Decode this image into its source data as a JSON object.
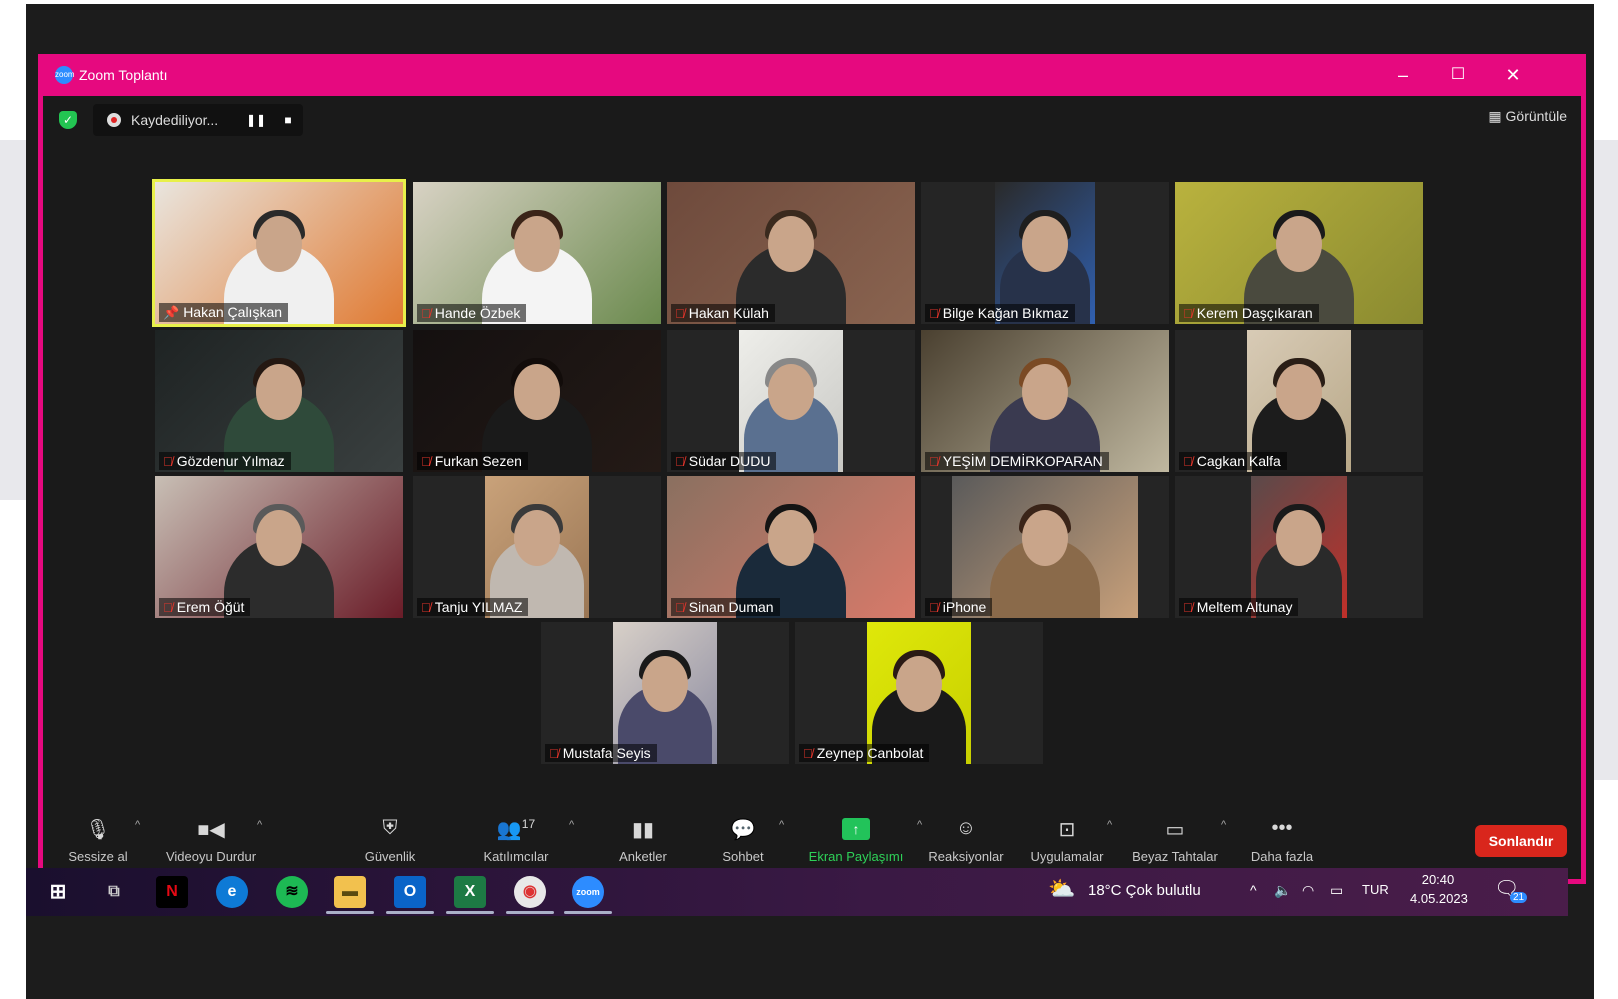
{
  "window": {
    "title": "Zoom Toplantı",
    "minimize": "–",
    "maximize": "☐",
    "close": "✕"
  },
  "topbar": {
    "recording_label": "Kaydediliyor...",
    "pause": "❚❚",
    "stop": "■",
    "view_label": "Görüntüle"
  },
  "participants": [
    {
      "name": "Hakan Çalışkan",
      "pinned": true,
      "bg": "#e9e5de",
      "accent": "#e07a32",
      "shirt": "#f0f0f0",
      "hair": "#2a2a2a"
    },
    {
      "name": "Hande Özbek",
      "muted": false,
      "bg": "#d8d2c4",
      "accent": "#6b8a4e",
      "shirt": "#f4f4f4",
      "hair": "#3a2418"
    },
    {
      "name": "Hakan Külah",
      "bg": "#6e4a3c",
      "accent": "#8a6450",
      "shirt": "#2b2b2b",
      "hair": "#3a2a1e"
    },
    {
      "name": "Bilge Kağan Bıkmaz",
      "bg": "#2a2a2a",
      "accent": "#3060b0",
      "shirt": "#27324a",
      "hair": "#1e1e1e"
    },
    {
      "name": "Kerem Daşçıkaran",
      "bg": "#b9b23e",
      "accent": "#8a8a30",
      "shirt": "#4a4a3e",
      "hair": "#1a1a1a"
    },
    {
      "name": "Gözdenur Yılmaz",
      "bg": "#1e2323",
      "accent": "#3a4040",
      "shirt": "#2f4a3a",
      "hair": "#241812"
    },
    {
      "name": "Furkan Sezen",
      "bg": "#141010",
      "accent": "#241a16",
      "shirt": "#1a1a1a",
      "hair": "#120c0a"
    },
    {
      "name": "Südar DUDU",
      "bg": "#eeeeea",
      "accent": "#c8c8c4",
      "shirt": "#5a7090",
      "hair": "#888"
    },
    {
      "name": "YEŞİM DEMİRKOPARAN",
      "bg": "#4a4030",
      "accent": "#c0b8a0",
      "shirt": "#3a3a50",
      "hair": "#7a4a24"
    },
    {
      "name": "Cagkan Kalfa",
      "bg": "#d8cbb6",
      "accent": "#b8a888",
      "shirt": "#1c1c1c",
      "hair": "#2a1e16"
    },
    {
      "name": "Erem Öğüt",
      "bg": "#c8bfb5",
      "accent": "#6a1c28",
      "shirt": "#2c2c2c",
      "hair": "#5a5a5a"
    },
    {
      "name": "Tanju YILMAZ",
      "bg": "#c9a27a",
      "accent": "#9a7654",
      "shirt": "#c0b8b0",
      "hair": "#3a3a3a"
    },
    {
      "name": "Sinan Duman",
      "bg": "#8a7060",
      "accent": "#d87a6a",
      "shirt": "#1a2a3a",
      "hair": "#141414"
    },
    {
      "name": "iPhone",
      "bg": "#5a5a5a",
      "accent": "#c8a07a",
      "shirt": "#8a6a4a",
      "hair": "#3a2418"
    },
    {
      "name": "Meltem Altunay",
      "bg": "#5a4a4a",
      "accent": "#c0302a",
      "shirt": "#2a2a2a",
      "hair": "#1a1a1a"
    },
    {
      "name": "Mustafa Seyis",
      "bg": "#d8d0c8",
      "accent": "#8a8aa0",
      "shirt": "#4a4a6a",
      "hair": "#1a1a1a"
    },
    {
      "name": "Zeynep Canbolat",
      "bg": "#dfe80a",
      "accent": "#c8d000",
      "shirt": "#1a1a1a",
      "hair": "#2a1a14"
    }
  ],
  "toolbar": {
    "mute": "Sessize al",
    "video": "Videoyu Durdur",
    "security": "Güvenlik",
    "participants": "Katılımcılar",
    "participants_count": "17",
    "polls": "Anketler",
    "chat": "Sohbet",
    "share": "Ekran Paylaşımı",
    "reactions": "Reaksiyonlar",
    "apps": "Uygulamalar",
    "whiteboards": "Beyaz Tahtalar",
    "more": "Daha fazla",
    "end": "Sonlandır",
    "caret": "^"
  },
  "taskbar": {
    "weather": "18°C  Çok bulutlu",
    "lang": "TUR",
    "time": "20:40",
    "date": "4.05.2023",
    "notifications": "21",
    "apps": [
      "windows-start",
      "task-view",
      "netflix",
      "edge",
      "spotify",
      "file-explorer",
      "outlook",
      "excel",
      "chrome",
      "zoom"
    ]
  }
}
